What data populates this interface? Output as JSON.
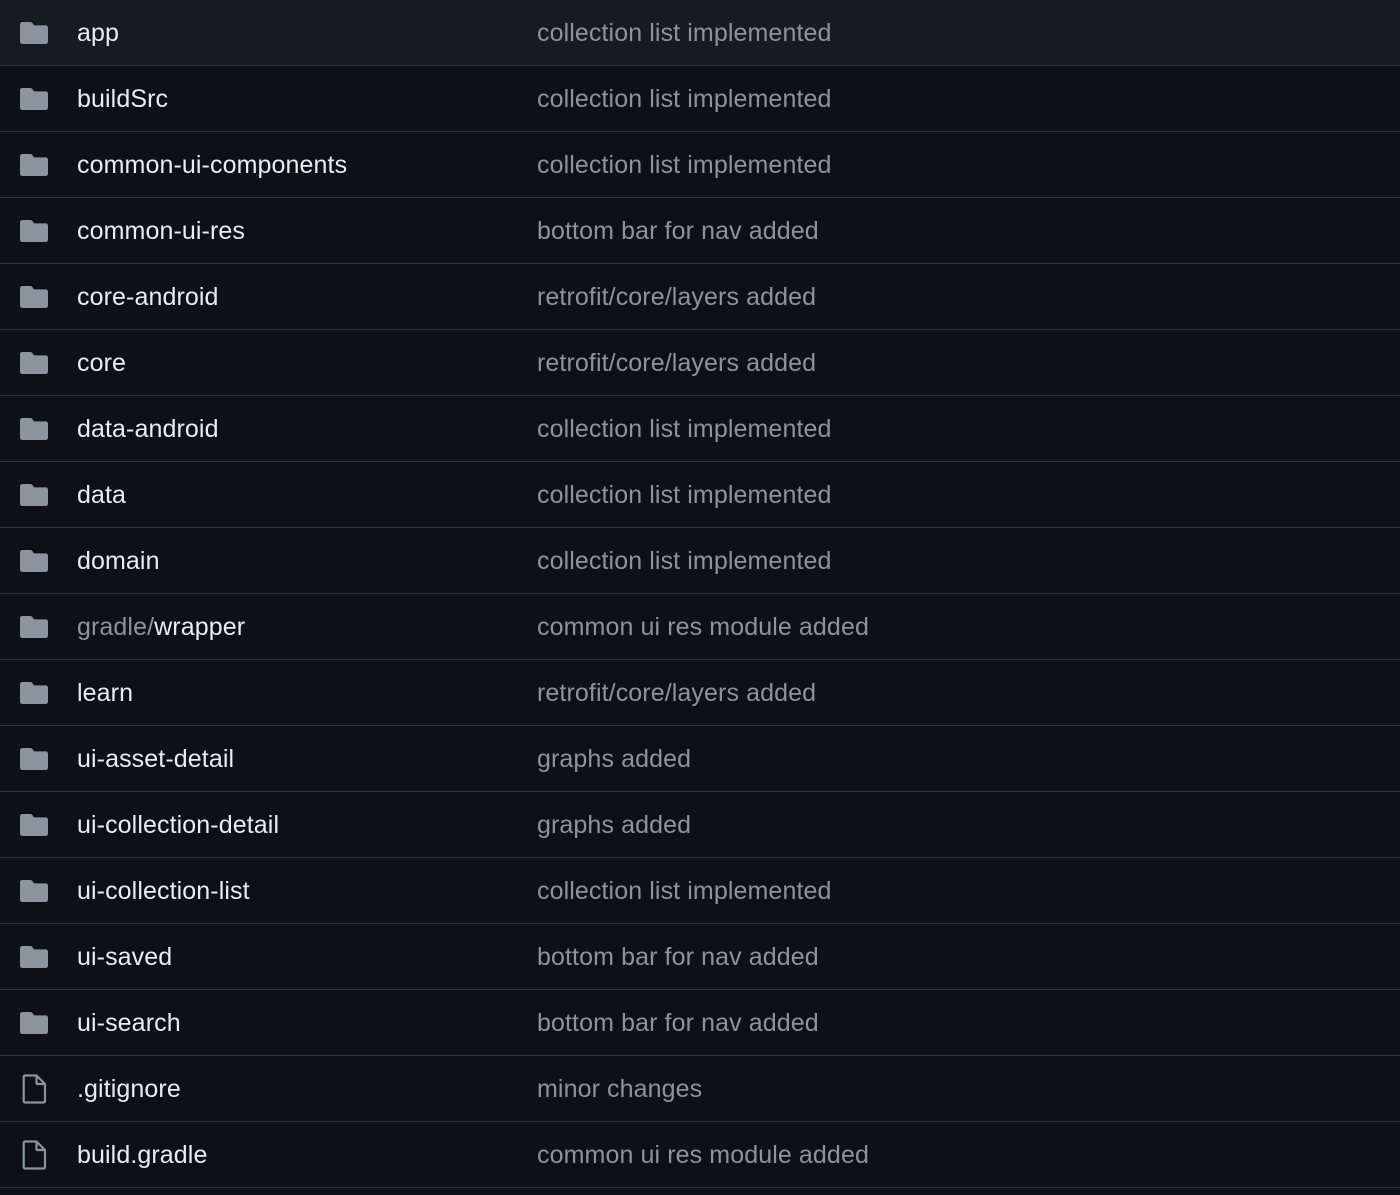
{
  "colors": {
    "background": "#0d1117",
    "divider": "#30363d",
    "name_text": "#e6edf3",
    "muted_text": "#8b949e",
    "folder_icon": "#8b949e"
  },
  "files": [
    {
      "type": "folder",
      "icon": "folder-icon",
      "name_prefix": "",
      "name": "app",
      "message": "collection list implemented"
    },
    {
      "type": "folder",
      "icon": "folder-icon",
      "name_prefix": "",
      "name": "buildSrc",
      "message": "collection list implemented"
    },
    {
      "type": "folder",
      "icon": "folder-icon",
      "name_prefix": "",
      "name": "common-ui-components",
      "message": "collection list implemented"
    },
    {
      "type": "folder",
      "icon": "folder-icon",
      "name_prefix": "",
      "name": "common-ui-res",
      "message": "bottom bar for nav added"
    },
    {
      "type": "folder",
      "icon": "folder-icon",
      "name_prefix": "",
      "name": "core-android",
      "message": "retrofit/core/layers added"
    },
    {
      "type": "folder",
      "icon": "folder-icon",
      "name_prefix": "",
      "name": "core",
      "message": "retrofit/core/layers added"
    },
    {
      "type": "folder",
      "icon": "folder-icon",
      "name_prefix": "",
      "name": "data-android",
      "message": "collection list implemented"
    },
    {
      "type": "folder",
      "icon": "folder-icon",
      "name_prefix": "",
      "name": "data",
      "message": "collection list implemented"
    },
    {
      "type": "folder",
      "icon": "folder-icon",
      "name_prefix": "",
      "name": "domain",
      "message": "collection list implemented"
    },
    {
      "type": "folder",
      "icon": "folder-icon",
      "name_prefix": "gradle/",
      "name": "wrapper",
      "message": "common ui res module added"
    },
    {
      "type": "folder",
      "icon": "folder-icon",
      "name_prefix": "",
      "name": "learn",
      "message": "retrofit/core/layers added"
    },
    {
      "type": "folder",
      "icon": "folder-icon",
      "name_prefix": "",
      "name": "ui-asset-detail",
      "message": "graphs added"
    },
    {
      "type": "folder",
      "icon": "folder-icon",
      "name_prefix": "",
      "name": "ui-collection-detail",
      "message": "graphs added"
    },
    {
      "type": "folder",
      "icon": "folder-icon",
      "name_prefix": "",
      "name": "ui-collection-list",
      "message": "collection list implemented"
    },
    {
      "type": "folder",
      "icon": "folder-icon",
      "name_prefix": "",
      "name": "ui-saved",
      "message": "bottom bar for nav added"
    },
    {
      "type": "folder",
      "icon": "folder-icon",
      "name_prefix": "",
      "name": "ui-search",
      "message": "bottom bar for nav added"
    },
    {
      "type": "file",
      "icon": "file-icon",
      "name_prefix": "",
      "name": ".gitignore",
      "message": "minor changes"
    },
    {
      "type": "file",
      "icon": "file-icon",
      "name_prefix": "",
      "name": "build.gradle",
      "message": "common ui res module added"
    }
  ]
}
